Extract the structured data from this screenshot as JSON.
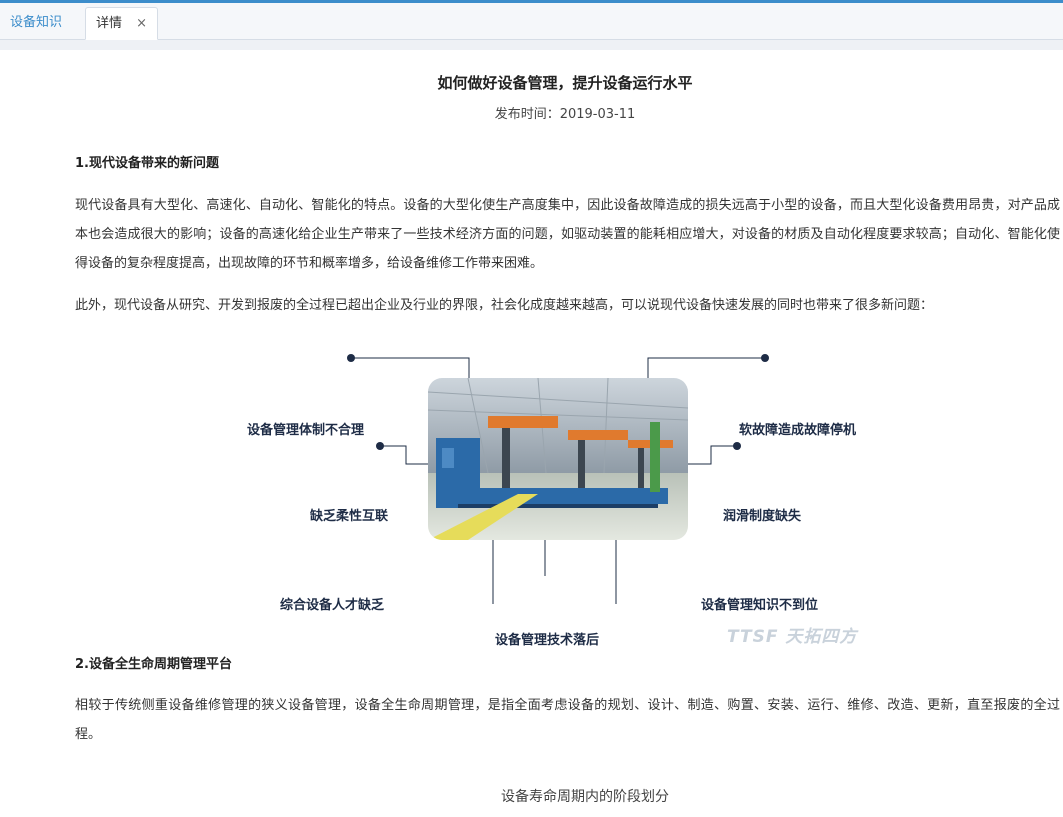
{
  "tabs": {
    "knowledge_label": "设备知识",
    "detail_label": "详情",
    "close_symbol": "×"
  },
  "article": {
    "title": "如何做好设备管理，提升设备运行水平",
    "publish_date": "发布时间：2019-03-11",
    "section1": {
      "heading": "1.现代设备带来的新问题",
      "para1": "现代设备具有大型化、高速化、自动化、智能化的特点。设备的大型化使生产高度集中，因此设备故障造成的损失远高于小型的设备，而且大型化设备费用昂贵，对产品成本也会造成很大的影响；设备的高速化给企业生产带来了一些技术经济方面的问题，如驱动装置的能耗相应增大，对设备的材质及自动化程度要求较高；自动化、智能化使得设备的复杂程度提高，出现故障的环节和概率增多，给设备维修工作带来困难。",
      "para2": "此外，现代设备从研究、开发到报废的全过程已超出企业及行业的界限，社会化成度越来越高，可以说现代设备快速发展的同时也带来了很多新问题："
    },
    "figure1": {
      "labels": {
        "system": "设备管理体制不合理",
        "soft_fault": "软故障造成故障停机",
        "flex": "缺乏柔性互联",
        "lube": "润滑制度缺失",
        "talent": "综合设备人才缺乏",
        "knowledge": "设备管理知识不到位",
        "tech": "设备管理技术落后"
      },
      "watermark": "TTSF 天拓四方"
    },
    "section2": {
      "heading": "2.设备全生命周期管理平台",
      "para1": "相较于传统侧重设备维修管理的狭义设备管理，设备全生命周期管理，是指全面考虑设备的规划、设计、制造、购置、安装、运行、维修、改造、更新，直至报废的全过程。"
    },
    "figure2_title": "设备寿命周期内的阶段划分"
  },
  "colors": {
    "accent": "#3c8dcb",
    "line": "#1e2c46",
    "tab_border": "#d6dde6"
  }
}
